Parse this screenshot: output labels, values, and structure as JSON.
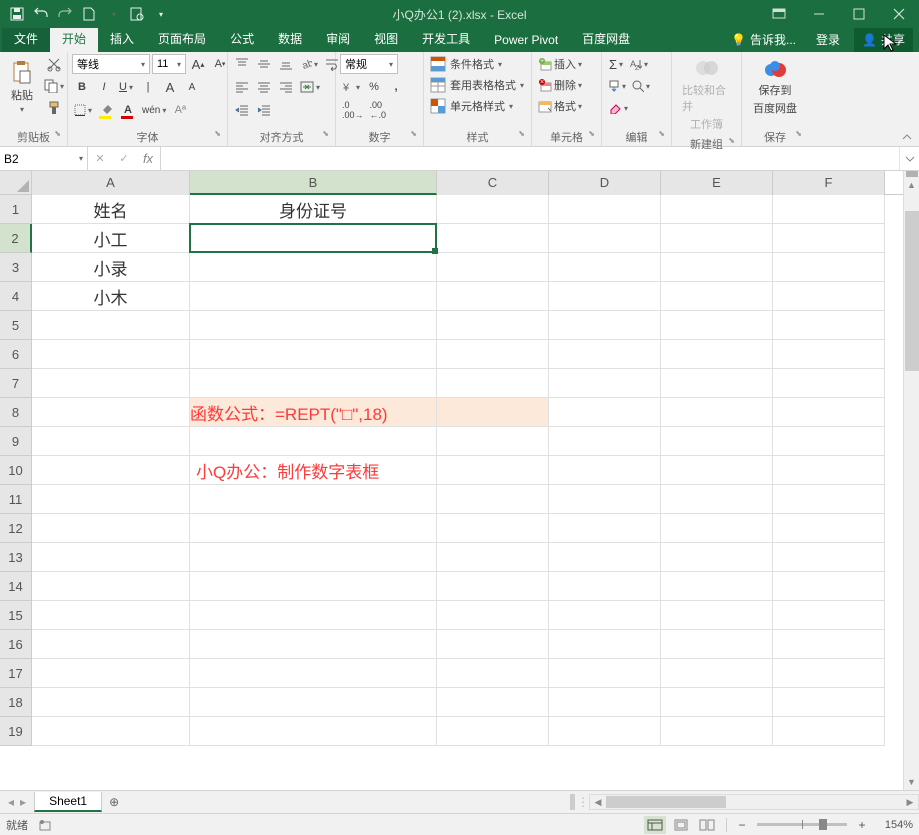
{
  "titlebar": {
    "title": "小Q办公1 (2).xlsx - Excel"
  },
  "tabs": {
    "file": "文件",
    "home": "开始",
    "insert": "插入",
    "pagelayout": "页面布局",
    "formulas": "公式",
    "data": "数据",
    "review": "审阅",
    "view": "视图",
    "dev": "开发工具",
    "powerpivot": "Power Pivot",
    "baidu": "百度网盘",
    "tellme": "告诉我...",
    "login": "登录",
    "share": "共享"
  },
  "ribbon": {
    "clipboard": {
      "paste": "粘贴",
      "label": "剪贴板"
    },
    "font": {
      "name": "等线",
      "size": "11",
      "label": "字体"
    },
    "align": {
      "label": "对齐方式"
    },
    "number": {
      "format": "常规",
      "label": "数字"
    },
    "styles": {
      "cond": "条件格式",
      "table": "套用表格格式",
      "cell": "单元格样式",
      "label": "样式"
    },
    "cells": {
      "insert": "插入",
      "delete": "删除",
      "format": "格式",
      "label": "单元格"
    },
    "editing": {
      "label": "编辑"
    },
    "compare": {
      "line1": "比较和合并",
      "line2": "工作簿",
      "label": "新建组"
    },
    "save": {
      "line1": "保存到",
      "line2": "百度网盘",
      "label": "保存"
    }
  },
  "namebox": "B2",
  "formula": "",
  "cols": [
    "A",
    "B",
    "C",
    "D",
    "E",
    "F"
  ],
  "rows": [
    "1",
    "2",
    "3",
    "4",
    "5",
    "6",
    "7",
    "8",
    "9",
    "10",
    "11",
    "12",
    "13",
    "14",
    "15",
    "16",
    "17",
    "18",
    "19"
  ],
  "cells": {
    "A1": "姓名",
    "B1": "身份证号",
    "A2": "小工",
    "A3": "小录",
    "A4": "小木",
    "B8": "函数公式：=REPT(\"□\",18)",
    "B10": "小Q办公：制作数字表框"
  },
  "sheet_tabs": {
    "sheet1": "Sheet1"
  },
  "statusbar": {
    "ready": "就绪",
    "zoom": "154%"
  }
}
